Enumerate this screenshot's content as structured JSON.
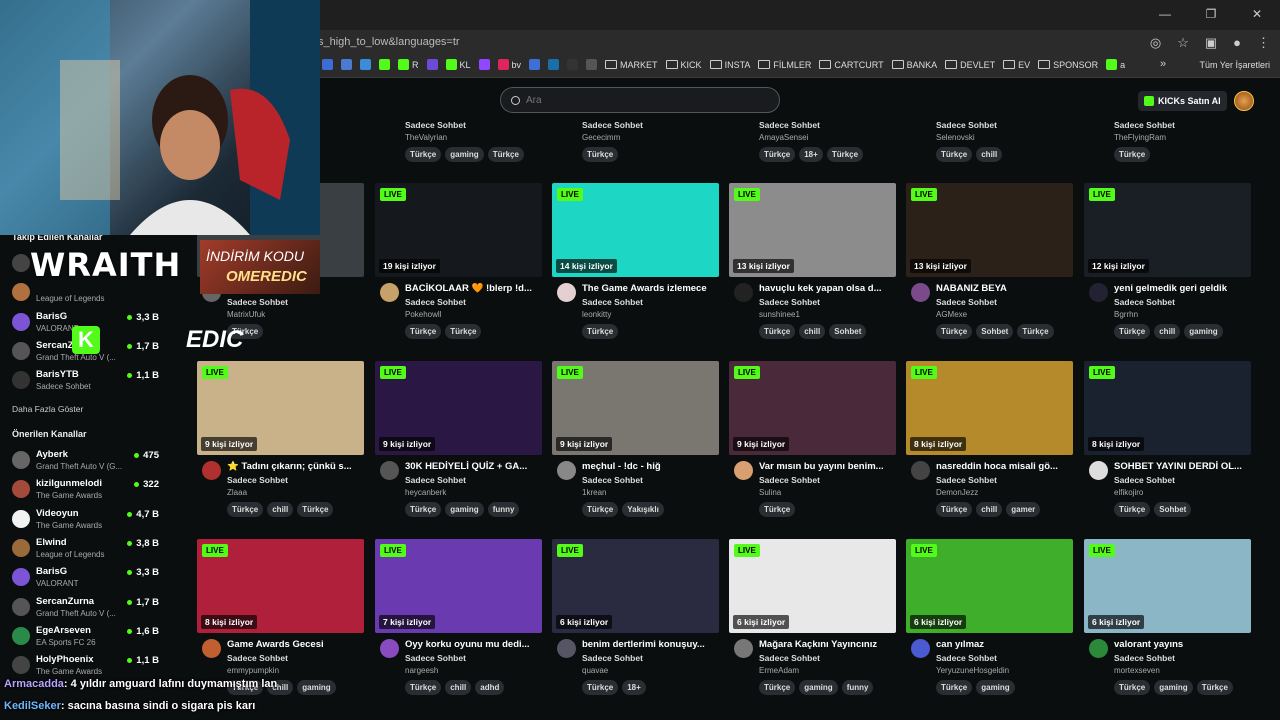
{
  "browser": {
    "url_fragment": "s_high_to_low&languages=tr",
    "bookmarks": [
      {
        "label": "",
        "color": "#3d6cd6"
      },
      {
        "label": "",
        "color": "#4a7bd0"
      },
      {
        "label": "",
        "color": "#3b8dd9"
      },
      {
        "label": "",
        "color": "#53fc18"
      },
      {
        "label": "R",
        "color": "#53fc18"
      },
      {
        "label": "",
        "color": "#6b4bd6"
      },
      {
        "label": "KL",
        "color": "#53fc18"
      },
      {
        "label": "",
        "color": "#9146ff"
      },
      {
        "label": "bv",
        "color": "#e0245e"
      },
      {
        "label": "",
        "color": "#3f6fd6"
      },
      {
        "label": "",
        "color": "#1b6fa8"
      },
      {
        "label": "",
        "color": "#333333"
      },
      {
        "label": "",
        "color": "#555555"
      }
    ],
    "folders": [
      "MARKET",
      "KICK",
      "INSTA",
      "FİLMLER",
      "CARTCURT",
      "BANKA",
      "DEVLET",
      "EV",
      "SPONSOR"
    ],
    "last_bookmark": "a",
    "all_bookmarks": "Tüm Yer İşaretleri"
  },
  "header": {
    "search_placeholder": "Ara",
    "buy_kicks": "KICKs Satın Al"
  },
  "sidebar": {
    "followed_title": "Takip Edilen Kanallar",
    "followed": [
      {
        "name": "",
        "game": "",
        "count": "",
        "color": "#444"
      },
      {
        "name": "",
        "game": "League of Legends",
        "count": "",
        "color": "#b07040"
      },
      {
        "name": "BarisG",
        "game": "VALORANT",
        "count": "3,3 B",
        "color": "#7c54d6"
      },
      {
        "name": "SercanZurna",
        "game": "Grand Theft Auto V (...",
        "count": "1,7 B",
        "color": "#555"
      },
      {
        "name": "BarisYTB",
        "game": "Sadece Sohbet",
        "count": "1,1 B",
        "color": "#333"
      }
    ],
    "show_more": "Daha Fazla Göster",
    "recommended_title": "Önerilen Kanallar",
    "recommended": [
      {
        "name": "Ayberk",
        "game": "Grand Theft Auto V (G...",
        "count": "475",
        "color": "#666"
      },
      {
        "name": "kizilgunmelodi",
        "game": "The Game Awards",
        "count": "322",
        "color": "#a34a3a"
      },
      {
        "name": "Videoyun",
        "game": "The Game Awards",
        "count": "4,7 B",
        "color": "#f2f2f2"
      },
      {
        "name": "Elwind",
        "game": "League of Legends",
        "count": "3,8 B",
        "color": "#9a6a3a"
      },
      {
        "name": "BarisG",
        "game": "VALORANT",
        "count": "3,3 B",
        "color": "#7c54d6"
      },
      {
        "name": "SercanZurna",
        "game": "Grand Theft Auto V (...",
        "count": "1,7 B",
        "color": "#555"
      },
      {
        "name": "EgeArseven",
        "game": "EA Sports FC 26",
        "count": "1,6 B",
        "color": "#2a8a4a"
      },
      {
        "name": "HolyPhoenix",
        "game": "The Game Awards",
        "count": "1,1 B",
        "color": "#444"
      }
    ]
  },
  "top_row": [
    {
      "category": "Sadece Sohbet",
      "user": "TheValyrian",
      "tags": [
        "Türkçe",
        "gaming",
        "Türkçe"
      ]
    },
    {
      "category": "Sadece Sohbet",
      "user": "Gececimm",
      "tags": [
        "Türkçe"
      ]
    },
    {
      "category": "Sadece Sohbet",
      "user": "AmayaSensei",
      "tags": [
        "Türkçe",
        "18+",
        "Türkçe"
      ]
    },
    {
      "category": "Sadece Sohbet",
      "user": "Selenovski",
      "tags": [
        "Türkçe",
        "chill"
      ]
    },
    {
      "category": "Sadece Sohbet",
      "user": "TheFlyingRam",
      "tags": [
        "Türkçe"
      ]
    }
  ],
  "live_label": "LIVE",
  "streams": [
    {
      "viewers": "",
      "title": "",
      "category": "Sadece Sohbet",
      "user": "MatrixUfuk",
      "tags": [
        "Türkçe"
      ],
      "thumb": "#3a3f44",
      "av": "#666"
    },
    {
      "viewers": "19 kişi izliyor",
      "title": "BACİKOLAAR 🧡 !blerp !d...",
      "category": "Sadece Sohbet",
      "user": "Pokehowll",
      "tags": [
        "Türkçe",
        "Türkçe"
      ],
      "thumb": "#15181c",
      "av": "#c7a06a"
    },
    {
      "viewers": "14 kişi izliyor",
      "title": "The Game Awards izlemece",
      "category": "Sadece Sohbet",
      "user": "leonkitty",
      "tags": [
        "Türkçe"
      ],
      "thumb": "#1dd6c4",
      "av": "#e4d0d0"
    },
    {
      "viewers": "13 kişi izliyor",
      "title": "havuçlu kek yapan olsa d...",
      "category": "Sadece Sohbet",
      "user": "sunshinee1",
      "tags": [
        "Türkçe",
        "chill",
        "Sohbet"
      ],
      "thumb": "#8c8c8c",
      "av": "#222"
    },
    {
      "viewers": "13 kişi izliyor",
      "title": "NABANIZ BEYA",
      "category": "Sadece Sohbet",
      "user": "AGMexe",
      "tags": [
        "Türkçe",
        "Sohbet",
        "Türkçe"
      ],
      "thumb": "#2b2118",
      "av": "#7a4a8a"
    },
    {
      "viewers": "12 kişi izliyor",
      "title": "yeni gelmedik geri geldik",
      "category": "Sadece Sohbet",
      "user": "Bgrrhn",
      "tags": [
        "Türkçe",
        "chill",
        "gaming"
      ],
      "thumb": "#1a1f26",
      "av": "#223"
    },
    {
      "viewers": "9 kişi izliyor",
      "title": "⭐ Tadını çıkarın; çünkü s...",
      "category": "Sadece Sohbet",
      "user": "Zlaaa",
      "tags": [
        "Türkçe",
        "chill",
        "Türkçe"
      ],
      "thumb": "#c9b28a",
      "av": "#b03030"
    },
    {
      "viewers": "9 kişi izliyor",
      "title": "30K HEDİYELİ QUİZ + GA...",
      "category": "Sadece Sohbet",
      "user": "heycanberk",
      "tags": [
        "Türkçe",
        "gaming",
        "funny"
      ],
      "thumb": "#2a1744",
      "av": "#555"
    },
    {
      "viewers": "9 kişi izliyor",
      "title": "meçhul - !dc - hiğ",
      "category": "Sadece Sohbet",
      "user": "1krean",
      "tags": [
        "Türkçe",
        "Yakışıklı"
      ],
      "thumb": "#7a7670",
      "av": "#888"
    },
    {
      "viewers": "9 kişi izliyor",
      "title": "Var mısın bu yayını benim...",
      "category": "Sadece Sohbet",
      "user": "Sulina",
      "tags": [
        "Türkçe"
      ],
      "thumb": "#4a2a3a",
      "av": "#d8a070"
    },
    {
      "viewers": "8 kişi izliyor",
      "title": "nasreddin hoca misali gö...",
      "category": "Sadece Sohbet",
      "user": "DemonJezz",
      "tags": [
        "Türkçe",
        "chill",
        "gamer"
      ],
      "thumb": "#b58a2a",
      "av": "#444"
    },
    {
      "viewers": "8 kişi izliyor",
      "title": "SOHBET YAYINI DERDİ OL...",
      "category": "Sadece Sohbet",
      "user": "elfikojiro",
      "tags": [
        "Türkçe",
        "Sohbet"
      ],
      "thumb": "#1a2230",
      "av": "#ddd"
    },
    {
      "viewers": "8 kişi izliyor",
      "title": "Game Awards Gecesi",
      "category": "Sadece Sohbet",
      "user": "emmypumpkin",
      "tags": [
        "Türkçe",
        "chill",
        "gaming"
      ],
      "thumb": "#b0203a",
      "av": "#c06030"
    },
    {
      "viewers": "7 kişi izliyor",
      "title": "Oyy korku oyunu mu dedi...",
      "category": "Sadece Sohbet",
      "user": "nargeesh",
      "tags": [
        "Türkçe",
        "chill",
        "adhd"
      ],
      "thumb": "#6a3ab0",
      "av": "#8a4ac0"
    },
    {
      "viewers": "6 kişi izliyor",
      "title": "benim dertlerimi konuşuy...",
      "category": "Sadece Sohbet",
      "user": "quavae",
      "tags": [
        "Türkçe",
        "18+"
      ],
      "thumb": "#2a2a40",
      "av": "#556"
    },
    {
      "viewers": "6 kişi izliyor",
      "title": "Mağara Kaçkını Yayıncınız",
      "category": "Sadece Sohbet",
      "user": "ErmeAdam",
      "tags": [
        "Türkçe",
        "gaming",
        "funny"
      ],
      "thumb": "#e8e8e8",
      "av": "#777"
    },
    {
      "viewers": "6 kişi izliyor",
      "title": "can yılmaz",
      "category": "Sadece Sohbet",
      "user": "YeryuzuneHosgeldin",
      "tags": [
        "Türkçe",
        "gaming"
      ],
      "thumb": "#3fae2a",
      "av": "#4a5ad0"
    },
    {
      "viewers": "6 kişi izliyor",
      "title": "valorant yayıns",
      "category": "Sadece Sohbet",
      "user": "mortexseven",
      "tags": [
        "Türkçe",
        "gaming",
        "Türkçe"
      ],
      "thumb": "#8ab6c6",
      "av": "#2a8a3a"
    }
  ],
  "overlay": {
    "wraith": "WRAITH",
    "promo_line1": "İNDİRİM KODU",
    "promo_line2": "OMEREDIC",
    "kick_k": "K",
    "edic": "EDIC"
  },
  "chat": [
    {
      "user": "Armacadda",
      "text": ": 4 yıldır amguard lafını duymamıştım lan"
    },
    {
      "user": "KedilSeker",
      "text": ": sacına basına sindi o sigara pis karı"
    }
  ]
}
